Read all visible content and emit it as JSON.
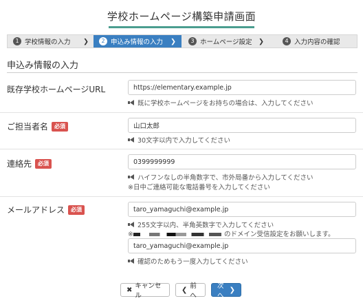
{
  "page": {
    "title": "学校ホームページ構築申請画面"
  },
  "steps": [
    {
      "num": "1",
      "label": "学校情報の入力",
      "active": false
    },
    {
      "num": "2",
      "label": "申込み情報の入力",
      "active": true
    },
    {
      "num": "3",
      "label": "ホームページ設定",
      "active": false
    },
    {
      "num": "4",
      "label": "入力内容の確認",
      "active": false
    }
  ],
  "section": {
    "title": "申込み情報の入力"
  },
  "form": {
    "required_badge": "必須",
    "existing_url": {
      "label": "既存学校ホームページURL",
      "value": "https://elementary.example.jp",
      "help": "既に学校ホームページをお持ちの場合は、入力してください"
    },
    "contact_person": {
      "label": "ご担当者名",
      "value": "山口太郎",
      "help": "30文字以内で入力してください"
    },
    "phone": {
      "label": "連絡先",
      "value": "0399999999",
      "help": "ハイフンなしの半角数字で、市外局番から入力してください",
      "note": "※日中ご連絡可能な電話番号を入力してください"
    },
    "email": {
      "label": "メールアドレス",
      "value": "taro_yamaguchi@example.jp",
      "help": "255文字以内、半角英数字で入力してください",
      "note_prefix": "※",
      "note_suffix": "のドメイン受信設定をお願いします。",
      "confirm_value": "taro_yamaguchi@example.jp",
      "confirm_help": "確認のためもう一度入力してください"
    }
  },
  "buttons": {
    "cancel": {
      "icon": "✖",
      "label": "キャンセル"
    },
    "back": {
      "icon": "❮",
      "label": "前へ"
    },
    "next": {
      "label": "次へ",
      "icon": "❯"
    }
  },
  "colors": {
    "accent": "#3a7fc1",
    "required": "#d9534f",
    "title_underline": "#4a9d8f"
  }
}
